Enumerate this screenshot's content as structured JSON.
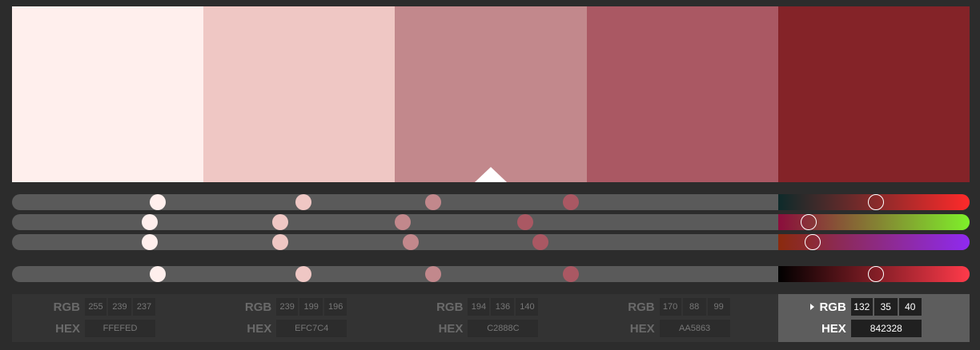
{
  "labels": {
    "rgb": "RGB",
    "hex": "HEX"
  },
  "selected_index": 4,
  "swatches": [
    {
      "hex": "FFEFED",
      "r": "255",
      "g": "239",
      "b": "237",
      "color": "#ffefed"
    },
    {
      "hex": "EFC7C4",
      "r": "239",
      "g": "199",
      "b": "196",
      "color": "#efc7c4"
    },
    {
      "hex": "C2888C",
      "r": "194",
      "g": "136",
      "b": "140",
      "color": "#c2888c"
    },
    {
      "hex": "AA5863",
      "r": "170",
      "g": "88",
      "b": "99",
      "color": "#aa5863"
    },
    {
      "hex": "842328",
      "r": "132",
      "g": "35",
      "b": "40",
      "color": "#842328"
    }
  ],
  "sliders": [
    {
      "name": "red-channel",
      "values": [
        0.19,
        0.38,
        0.55,
        0.73,
        0.51
      ],
      "gradient": [
        "#0d2a2a",
        "#ff2a2a"
      ]
    },
    {
      "name": "green-channel",
      "values": [
        0.18,
        0.35,
        0.51,
        0.67,
        0.16
      ],
      "gradient": [
        "#8b0d3c",
        "#7ef02a"
      ]
    },
    {
      "name": "blue-channel",
      "values": [
        0.18,
        0.35,
        0.52,
        0.69,
        0.18
      ],
      "gradient": [
        "#8b2a0d",
        "#8f2af0"
      ]
    },
    {
      "name": "brightness",
      "values": [
        0.19,
        0.38,
        0.55,
        0.73,
        0.51
      ],
      "gradient": [
        "#000000",
        "#ff3a4a"
      ]
    }
  ]
}
